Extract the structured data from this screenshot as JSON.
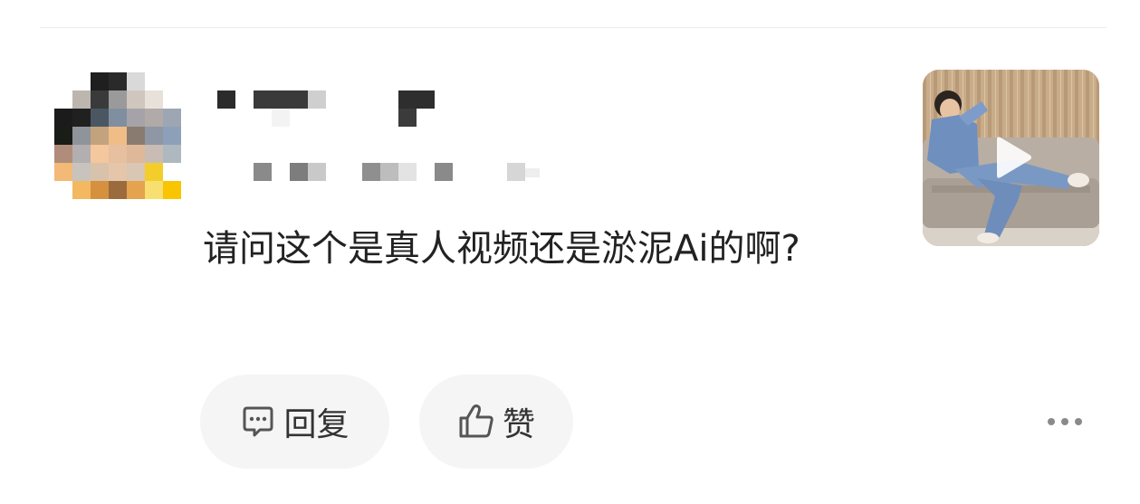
{
  "comment": {
    "text": "请问这个是真人视频还是淤泥Ai的啊?"
  },
  "actions": {
    "reply_label": "回复",
    "like_label": "赞"
  },
  "icons": {
    "reply": "comment-bubble-icon",
    "like": "thumbs-up-icon",
    "more": "more-horizontal-icon",
    "play": "play-icon"
  },
  "colors": {
    "text": "#222222",
    "pill_background": "#f5f5f5",
    "icon": "#555555"
  }
}
